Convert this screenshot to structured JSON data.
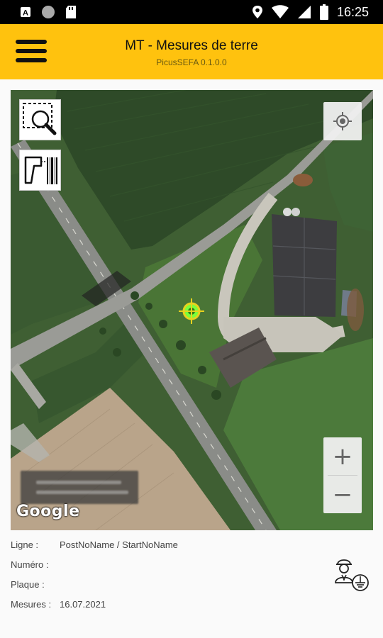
{
  "status_bar": {
    "time": "16:25",
    "icons": [
      "app-a-icon",
      "circle-icon",
      "sd-card-icon",
      "location-icon",
      "wifi-icon",
      "signal-icon",
      "battery-icon"
    ]
  },
  "app_bar": {
    "title": "MT - Mesures de terre",
    "subtitle": "PicusSEFA 0.1.0.0",
    "color": "#ffc20e"
  },
  "map": {
    "zoom_in": "+",
    "zoom_out": "−",
    "attribution": "Google",
    "tools": [
      "zoom-select-icon",
      "barcode-scanner-icon"
    ]
  },
  "info": {
    "ligne_label": "Ligne :",
    "ligne_value": "PostNoName / StartNoName",
    "numero_label": "Numéro :",
    "numero_value": "",
    "plaque_label": "Plaque :",
    "plaque_value": "",
    "mesures_label": "Mesures :",
    "mesures_value": "16.07.2021"
  }
}
